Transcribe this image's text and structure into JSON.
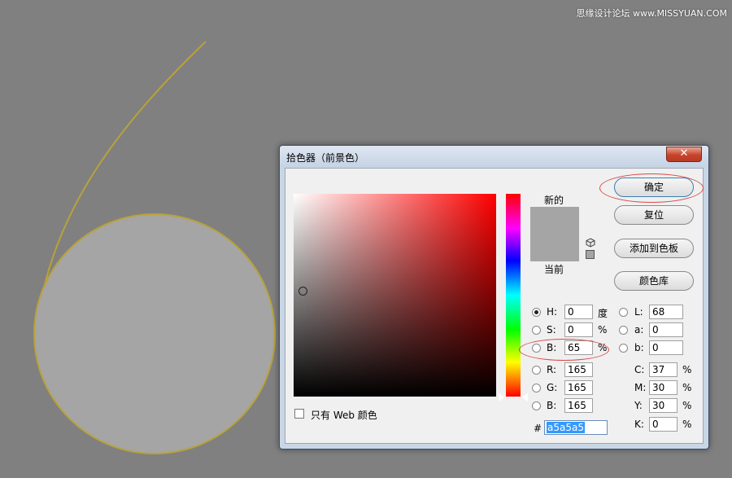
{
  "watermark": "思缘设计论坛 www.MISSYUAN.COM",
  "canvas": {
    "circle_fill": "#a5a5a5",
    "stroke_color": "#b8a23a",
    "background": "#808080"
  },
  "dialog": {
    "title": "拾色器（前景色）",
    "close_symbol": "✕",
    "labels": {
      "new": "新的",
      "current": "当前"
    },
    "buttons": {
      "ok": "确定",
      "reset": "复位",
      "add_to_swatches": "添加到色板",
      "color_libraries": "颜色库"
    },
    "hsb": {
      "h": {
        "label": "H:",
        "value": "0",
        "unit": "度"
      },
      "s": {
        "label": "S:",
        "value": "0",
        "unit": "%"
      },
      "b": {
        "label": "B:",
        "value": "65",
        "unit": "%"
      }
    },
    "rgb": {
      "r": {
        "label": "R:",
        "value": "165"
      },
      "g": {
        "label": "G:",
        "value": "165"
      },
      "b": {
        "label": "B:",
        "value": "165"
      }
    },
    "lab": {
      "l": {
        "label": "L:",
        "value": "68"
      },
      "a": {
        "label": "a:",
        "value": "0"
      },
      "b": {
        "label": "b:",
        "value": "0"
      }
    },
    "cmyk": {
      "c": {
        "label": "C:",
        "value": "37",
        "unit": "%"
      },
      "m": {
        "label": "M:",
        "value": "30",
        "unit": "%"
      },
      "y": {
        "label": "Y:",
        "value": "30",
        "unit": "%"
      },
      "k": {
        "label": "K:",
        "value": "0",
        "unit": "%"
      }
    },
    "hex": {
      "label": "#",
      "value": "a5a5a5"
    },
    "web_only": {
      "label": "只有 Web 颜色",
      "checked": false
    },
    "selected_color": "#a5a5a5"
  }
}
